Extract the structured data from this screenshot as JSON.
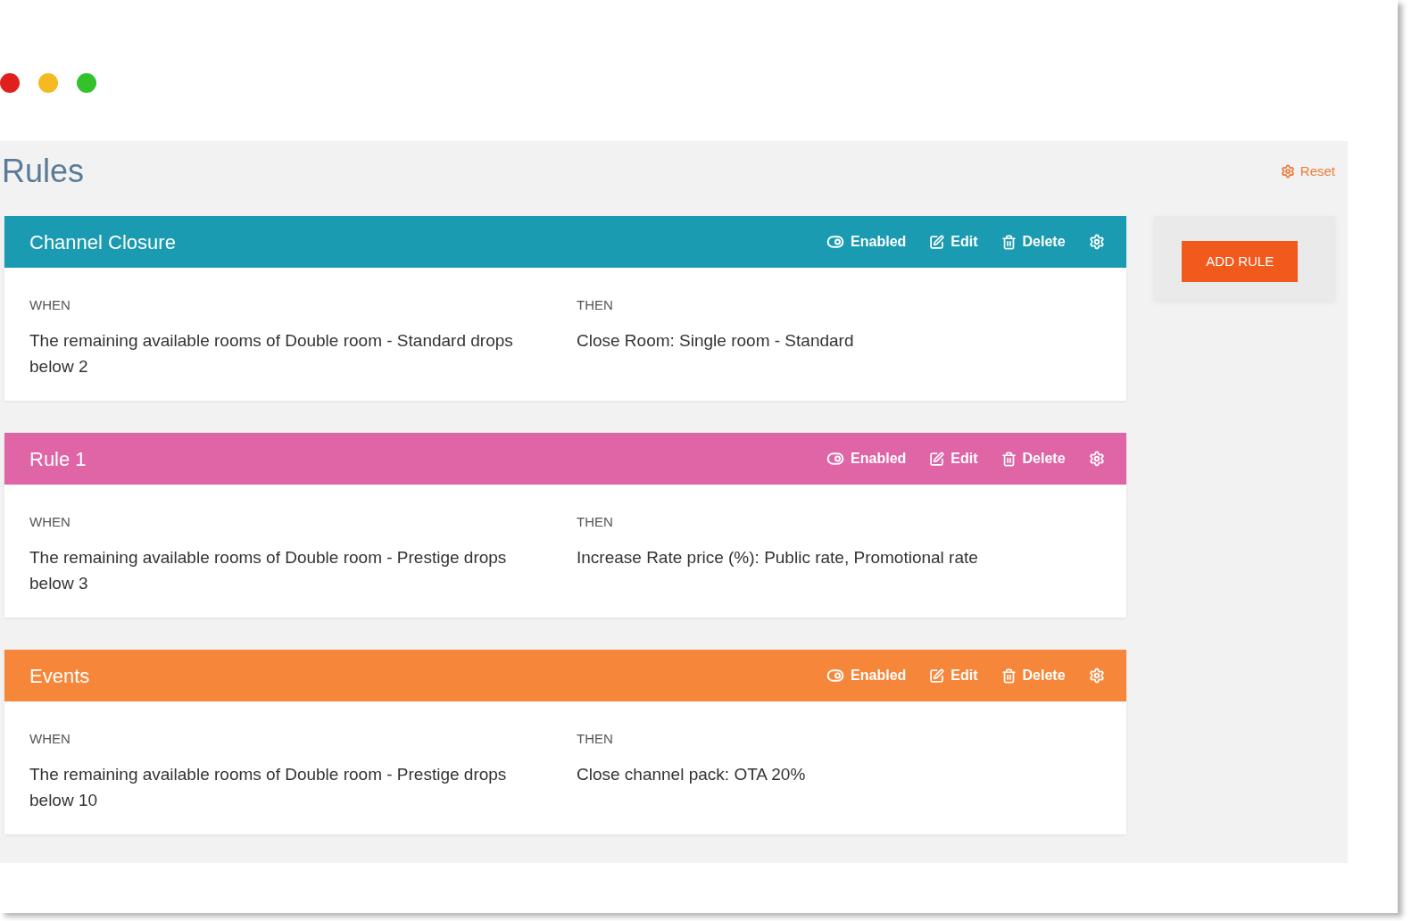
{
  "page": {
    "title": "Rules",
    "reset_link": "Reset"
  },
  "rules": [
    {
      "name": "Channel Closure",
      "color": "#1a9bb1",
      "enabled": true,
      "actions": [
        {
          "kind": "toggle",
          "label": "Enabled"
        },
        {
          "kind": "edit",
          "label": "Edit"
        },
        {
          "kind": "delete",
          "label": "Delete"
        },
        {
          "kind": "settings"
        }
      ],
      "when": {
        "label": "WHEN",
        "text": "The remaining available rooms of Double room - Standard drops below 2"
      },
      "then": {
        "label": "THEN",
        "text": "Close Room: Single room - Standard"
      }
    },
    {
      "name": "Rule 1",
      "color": "#e065a6",
      "enabled": true,
      "actions": [
        {
          "kind": "toggle",
          "label": "Enabled"
        },
        {
          "kind": "edit",
          "label": "Edit"
        },
        {
          "kind": "delete",
          "label": "Delete"
        },
        {
          "kind": "settings"
        }
      ],
      "when": {
        "label": "WHEN",
        "text": "The remaining available rooms of Double room - Prestige drops below 3"
      },
      "then": {
        "label": "THEN",
        "text": "Increase Rate price (%): Public rate, Promotional rate"
      }
    },
    {
      "name": "Events",
      "color": "#f6873a",
      "enabled": true,
      "actions": [
        {
          "kind": "toggle",
          "label": "Enabled"
        },
        {
          "kind": "edit",
          "label": "Edit"
        },
        {
          "kind": "delete",
          "label": "Delete"
        },
        {
          "kind": "settings"
        }
      ],
      "when": {
        "label": "WHEN",
        "text": "The remaining available rooms of Double room - Prestige drops below 10"
      },
      "then": {
        "label": "THEN",
        "text": "Close channel pack: OTA 20%"
      }
    }
  ],
  "add_button": "ADD RULE"
}
